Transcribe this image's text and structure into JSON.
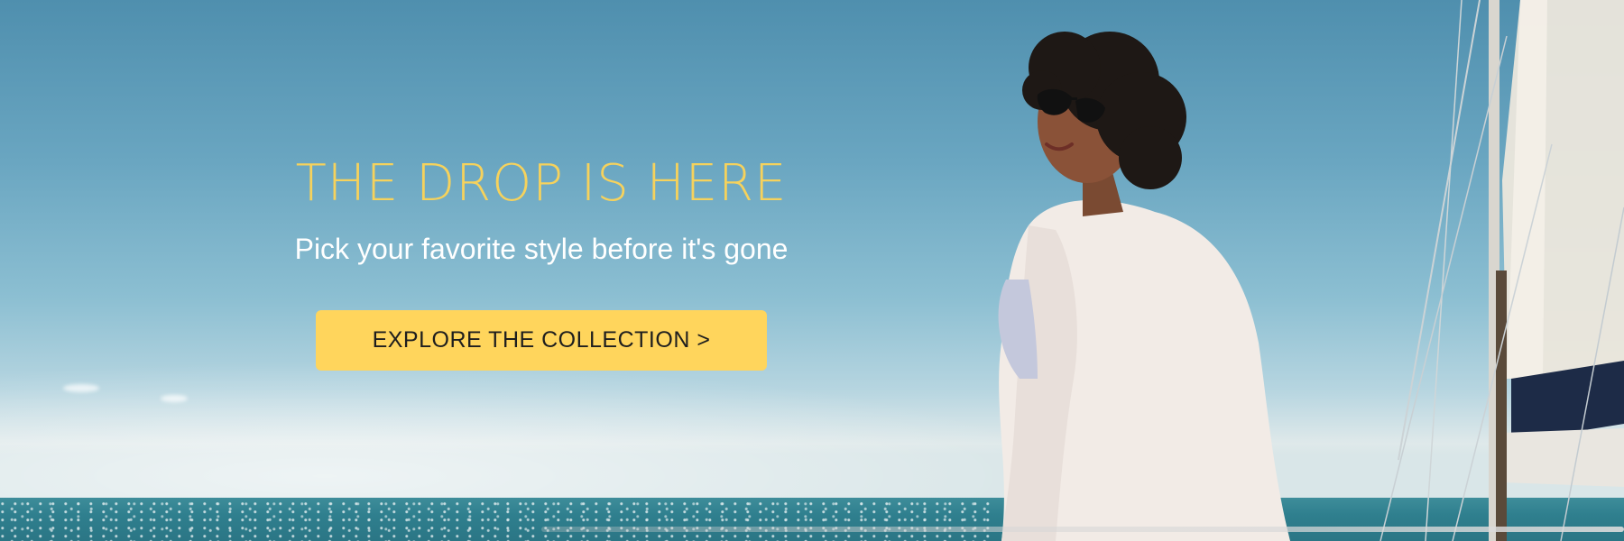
{
  "hero": {
    "headline": "THE DROP IS HERE",
    "subheadline": "Pick your favorite style before it's gone",
    "cta_label": "EXPLORE THE COLLECTION >"
  },
  "colors": {
    "headline": "#f6d25c",
    "cta_background": "#ffd55c",
    "cta_text": "#1e1e1e",
    "subheadline": "#ffffff",
    "sky": "#5f9bb7",
    "sea": "#2f7f8e"
  },
  "image": {
    "subject": "woman-in-sunglasses-on-sailboat"
  }
}
